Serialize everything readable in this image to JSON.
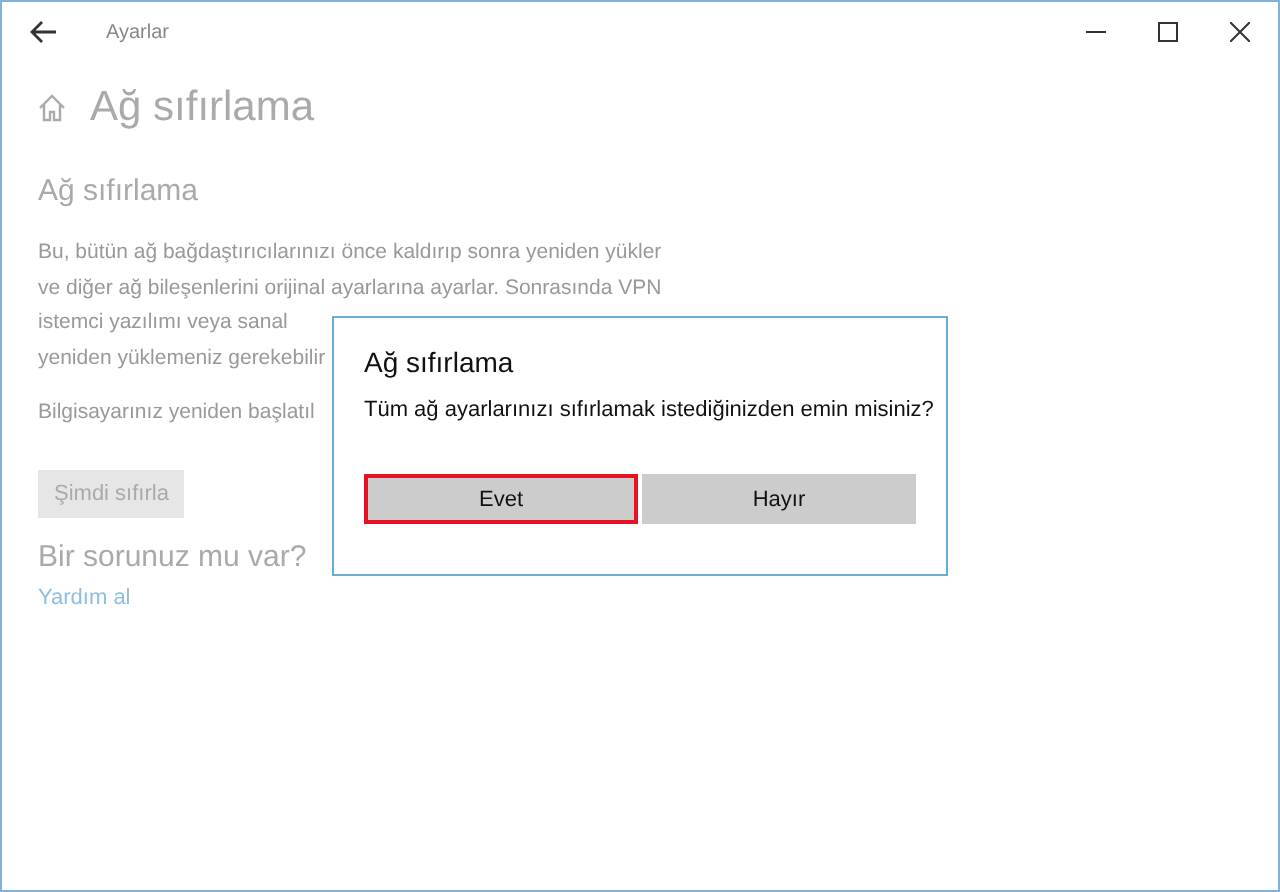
{
  "window": {
    "title": "Ayarlar"
  },
  "page": {
    "title": "Ağ sıfırlama",
    "section_title": "Ağ sıfırlama",
    "description_lines": [
      "Bu, bütün ağ bağdaştırıcılarınızı önce kaldırıp sonra yeniden yükler",
      "ve diğer ağ bileşenlerini orijinal ayarlarına ayarlar. Sonrasında VPN",
      "istemci yazılımı veya sanal",
      "yeniden yüklemeniz gerekebilir"
    ],
    "restart_note": "Bilgisayarınız yeniden başlatıl",
    "reset_button": "Şimdi sıfırla",
    "help_title": "Bir sorunuz mu var?",
    "help_link": "Yardım al"
  },
  "dialog": {
    "title": "Ağ sıfırlama",
    "message": "Tüm ağ ayarlarınızı sıfırlamak istediğinizden emin misiniz?",
    "buttons": [
      {
        "label": "Evet",
        "focused": true
      },
      {
        "label": "Hayır",
        "focused": false
      }
    ]
  }
}
